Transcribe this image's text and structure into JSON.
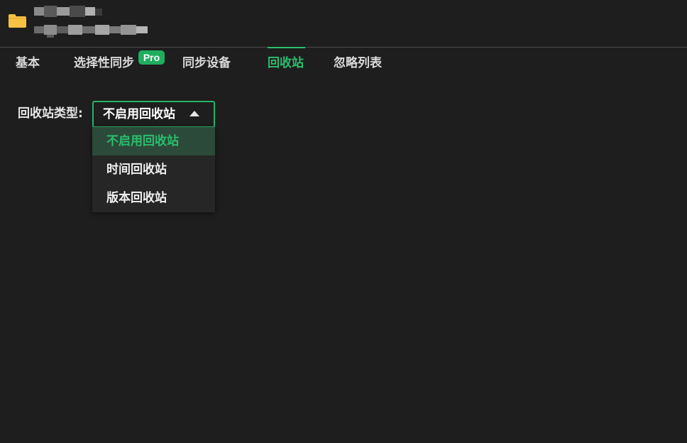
{
  "header": {
    "folder_icon": "folder-icon",
    "folder_color": "#f7c143"
  },
  "tabs": [
    {
      "label": "基本",
      "active": false
    },
    {
      "label": "选择性同步",
      "active": false,
      "badge": "Pro"
    },
    {
      "label": "同步设备",
      "active": false
    },
    {
      "label": "回收站",
      "active": true
    },
    {
      "label": "忽略列表",
      "active": false
    }
  ],
  "recycle": {
    "type_label": "回收站类型:",
    "selected_value": "不启用回收站",
    "options": [
      {
        "label": "不启用回收站",
        "selected": true
      },
      {
        "label": "时间回收站",
        "selected": false
      },
      {
        "label": "版本回收站",
        "selected": false
      }
    ]
  },
  "colors": {
    "accent": "#2bbd6e",
    "background": "#1e1e1e",
    "badge": "#1fae5f"
  }
}
